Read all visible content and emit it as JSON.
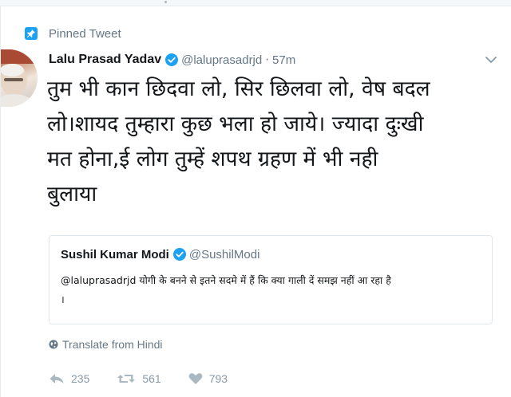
{
  "tweet": {
    "pinned_label": "Pinned Tweet",
    "author_name": "Lalu Prasad Yadav",
    "handle": "@laluprasadrjd",
    "separator": "·",
    "time": "57m",
    "text_lines": [
      "तुम भी कान छिदवा लो, सिर छिलवा लो, वेष बदल",
      "लो।शायद तुम्हारा कुछ भला हो जाये। ज्यादा दुःखी",
      "मत होना,ई लोग तुम्हें शपथ ग्रहण में भी नही",
      "बुलाया"
    ],
    "quote": {
      "author_name": "Sushil Kumar Modi",
      "handle": "@SushilModi",
      "text_lines": [
        "@laluprasadrjd योगी के बनने से इतने सदमे में हैं कि क्या गाली दें समझ नहीं आ रहा है",
        "।"
      ]
    },
    "translate_label": "Translate from Hindi",
    "actions": {
      "reply_count": "235",
      "retweet_count": "561",
      "like_count": "793"
    }
  },
  "colors": {
    "accent": "#1da1f2",
    "muted_text": "#657786",
    "action_gray": "#aab8c2",
    "border": "#e1e8ed"
  },
  "icons": [
    "pin-icon",
    "verified-badge-icon",
    "chevron-down-icon",
    "globe-icon",
    "reply-icon",
    "retweet-icon",
    "like-icon"
  ]
}
